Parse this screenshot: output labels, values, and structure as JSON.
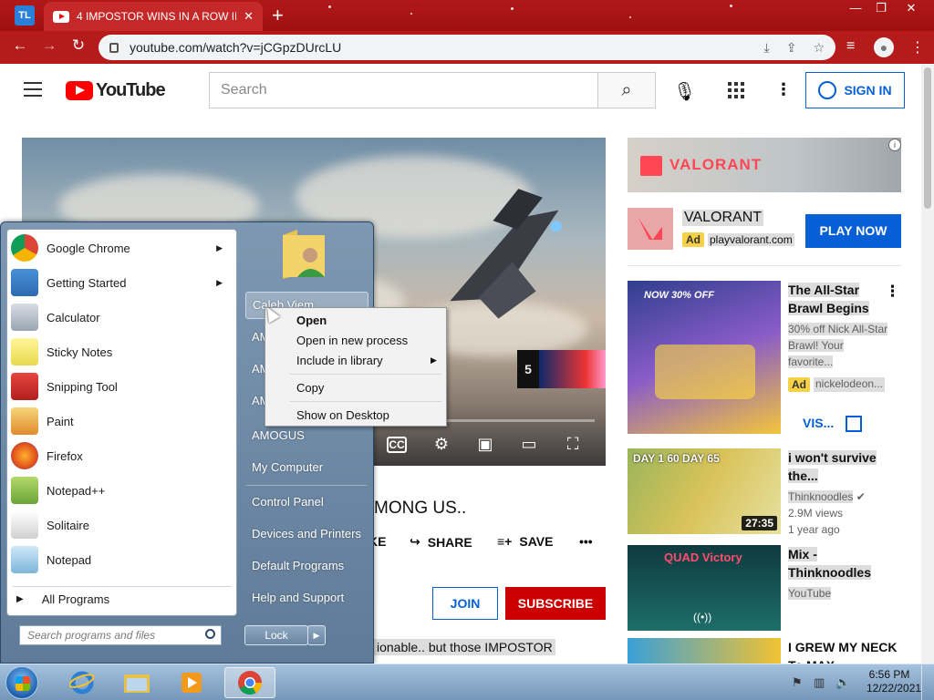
{
  "browser": {
    "profile_badge": "TL",
    "tab_title": "4 IMPOSTOR WINS IN A ROW IN",
    "url": "youtube.com/watch?v=jCGpzDUrcLU"
  },
  "youtube": {
    "logo_text": "YouTube",
    "search_placeholder": "Search",
    "sign_in": "SIGN IN"
  },
  "video": {
    "endcard_count": "5",
    "title_visible": "MONG US..",
    "actions": {
      "like": "KE",
      "share": "SHARE",
      "save": "SAVE"
    },
    "join": "JOIN",
    "subscribe": "SUBSCRIBE",
    "description_visible": "ionable.. but those IMPOSTOR"
  },
  "ad": {
    "banner_text": "VALORANT",
    "advertiser": "VALORANT",
    "badge": "Ad",
    "domain": "playvalorant.com",
    "cta": "PLAY NOW"
  },
  "recommendations": [
    {
      "title": "The All-Star Brawl Begins",
      "meta1": "30% off Nick All-Star Brawl! Your favorite...",
      "badge": "Ad",
      "channel": "nickelodeon...",
      "cta": "VIS...",
      "thumb_text": "NOW 30% OFF"
    },
    {
      "title": "i won't survive the...",
      "channel": "Thinknoodles",
      "views": "2.9M views",
      "age": "1 year ago",
      "duration": "27:35",
      "thumb_text": "DAY 1 60 DAY 65"
    },
    {
      "title": "Mix - Thinknoodles",
      "channel": "YouTube",
      "thumb_text": "QUAD Victory"
    },
    {
      "title": "I GREW MY NECK To MAX"
    }
  ],
  "start_menu": {
    "programs": [
      {
        "label": "Google Chrome",
        "icon": "chrome-icon",
        "has_submenu": true
      },
      {
        "label": "Getting Started",
        "icon": "getting-started-icon",
        "has_submenu": true
      },
      {
        "label": "Calculator",
        "icon": "calculator-icon",
        "has_submenu": false
      },
      {
        "label": "Sticky Notes",
        "icon": "sticky-notes-icon",
        "has_submenu": false
      },
      {
        "label": "Snipping Tool",
        "icon": "snipping-tool-icon",
        "has_submenu": false
      },
      {
        "label": "Paint",
        "icon": "paint-icon",
        "has_submenu": false
      },
      {
        "label": "Firefox",
        "icon": "firefox-icon",
        "has_submenu": false
      },
      {
        "label": "Notepad++",
        "icon": "notepadpp-icon",
        "has_submenu": false
      },
      {
        "label": "Solitaire",
        "icon": "solitaire-icon",
        "has_submenu": false
      },
      {
        "label": "Notepad",
        "icon": "notepad-icon",
        "has_submenu": false
      }
    ],
    "all_programs": "All Programs",
    "search_placeholder": "Search programs and files",
    "right": {
      "user": "Caleb Viem",
      "items": [
        "AM",
        "AM",
        "AM",
        "AMOGUS",
        "My Computer",
        "Control Panel",
        "Devices and Printers",
        "Default Programs",
        "Help and Support"
      ]
    },
    "lock": "Lock"
  },
  "context_menu": {
    "items": [
      "Open",
      "Open in new process",
      "Include in library",
      "Copy",
      "Show on Desktop"
    ]
  },
  "taskbar": {
    "time": "6:56 PM",
    "date": "12/22/2021"
  }
}
